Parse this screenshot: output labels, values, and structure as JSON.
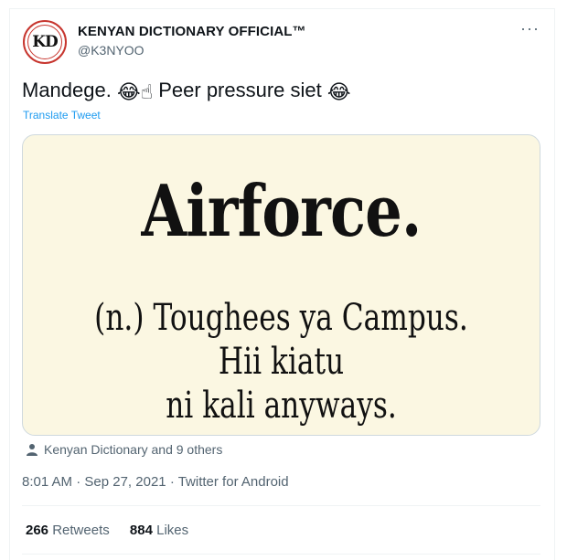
{
  "author": {
    "avatar_text": "KD",
    "display_name": "KENYAN DICTIONARY OFFICIAL™",
    "handle": "@K3NYOO"
  },
  "tweet": {
    "text_part1": "Mandege.",
    "emoji1": "😂",
    "emoji2": "☝",
    "text_part2": "Peer pressure siet",
    "emoji3": "😂",
    "translate_label": "Translate Tweet"
  },
  "media": {
    "title": "Airforce.",
    "definition_line1": "(n.) Toughees ya Campus. Hii kiatu",
    "definition_line2": "ni kali anyways."
  },
  "engagement_text": "Kenyan Dictionary and 9 others",
  "meta": {
    "time": "8:01 AM",
    "date": "Sep 27, 2021",
    "source": "Twitter for Android",
    "separator": "·"
  },
  "stats": {
    "retweets_count": "266",
    "retweets_label": "Retweets",
    "likes_count": "884",
    "likes_label": "Likes"
  },
  "more_label": "···",
  "colors": {
    "accent": "#1d9bf0",
    "muted": "#536471",
    "media_bg": "#fbf7e2"
  }
}
